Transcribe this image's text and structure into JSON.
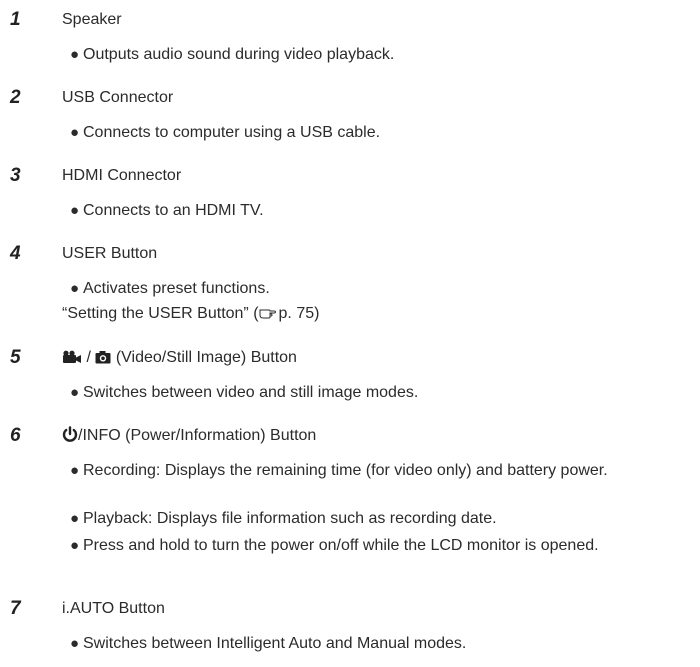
{
  "items": [
    {
      "number": "1",
      "title": "Speaker",
      "bullets": [
        "Outputs audio sound during video playback."
      ]
    },
    {
      "number": "2",
      "title": "USB Connector",
      "bullets": [
        "Connects to computer using a USB cable."
      ]
    },
    {
      "number": "3",
      "title": "HDMI Connector",
      "bullets": [
        "Connects to an HDMI TV."
      ]
    },
    {
      "number": "4",
      "title": "USER Button",
      "bullets": [
        "Activates preset functions."
      ],
      "reference": {
        "text": "“Setting the USER Button” (",
        "icon": "pointing-hand-icon",
        "page": "p. 75)"
      }
    },
    {
      "number": "5",
      "title_icons": [
        "video-camera-icon",
        "still-camera-icon"
      ],
      "title_separator": "/",
      "title": "(Video/Still Image) Button",
      "bullets": [
        "Switches between video and still image modes."
      ]
    },
    {
      "number": "6",
      "title_icon": "power-icon",
      "title": "/INFO (Power/Information) Button",
      "bullets": [
        "Recording: Displays the remaining time (for video only) and battery power.",
        "Playback: Displays file information such as recording date.",
        "Press and hold to turn the power on/off while the LCD monitor is opened."
      ]
    },
    {
      "number": "7",
      "title": "i.AUTO Button",
      "bullets": [
        "Switches between Intelligent Auto and Manual modes."
      ]
    }
  ],
  "bullet_glyph": "●"
}
